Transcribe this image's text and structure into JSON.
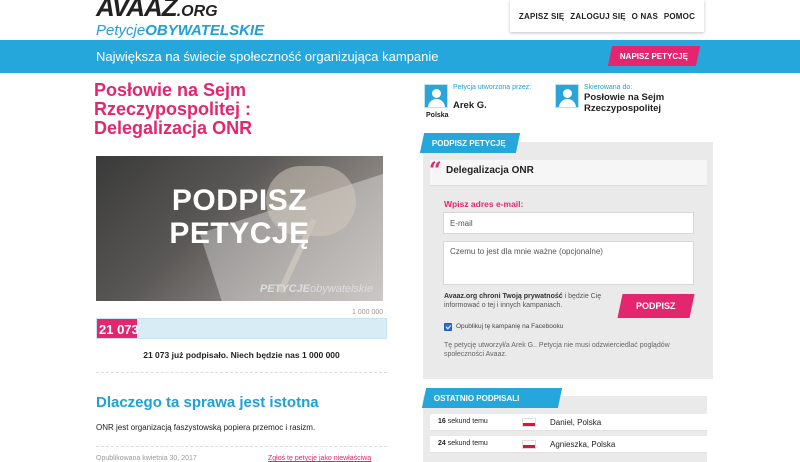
{
  "logo": {
    "main": "AVAAZ",
    "org": ".ORG",
    "sub_a": "Petycje",
    "sub_b": "OBYWATELSKIE"
  },
  "nav": {
    "items": [
      "ZAPISZ SIĘ",
      "ZALOGUJ SIĘ",
      "O NAS",
      "POMOC"
    ]
  },
  "banner": {
    "tagline": "Największa na świecie społeczność organizująca kampanie",
    "new_petition": "NAPISZ PETYCJĘ"
  },
  "petition": {
    "title": "Posłowie na Sejm Rzeczypospolitej : Delegalizacja ONR",
    "hero_line1": "PODPISZ",
    "hero_line2": "PETYCJĘ",
    "hero_brand_a": "PETYCJE",
    "hero_brand_b": "obywatelskie",
    "goal": "1 000 000",
    "count": "21 073",
    "progress_fraction": 0.021073,
    "signed_text": "21 073 już podpisało. Niech będzie nas 1 000 000",
    "why_title": "Dlaczego ta sprawa jest istotna",
    "why_text": "ONR jest organizacją faszystowską popiera przemoc i rasizm.",
    "published": "Opublikowana kwietnia 30, 2017",
    "report": "Zgłoś tę petycje jako niewłaściwą"
  },
  "creator": {
    "label": "Petycja utworzona przez:",
    "name": "Arek G.",
    "country": "Polska"
  },
  "recipient": {
    "label": "Skierowana do:",
    "name": "Posłowie na Sejm Rzeczypospolitej"
  },
  "sign": {
    "tab": "PODPISZ PETYCJĘ",
    "quote": "Delegalizacja ONR",
    "email_label": "Wpisz adres e-mail:",
    "email_placeholder": "E-mail",
    "reason_placeholder": "Czemu to jest dla mnie ważne (opcjonalne)",
    "privacy_bold": "Avaaz.org chroni Twoją prywatność",
    "privacy_rest": " i będzie Cię informować o tej i innych kampaniach.",
    "button": "PODPISZ",
    "fb_label": "Opublikuj tę kampanię na Facebooku",
    "disclaimer": "Tę petycję utworzył/a Arek G.. Petycja nie musi odzwierciedlać poglądów społeczności Avaaz."
  },
  "recent": {
    "tab": "OSTATNIO PODPISALI",
    "rows": [
      {
        "num": "16",
        "unit": " sekund temu",
        "name": "Daniel, Polska"
      },
      {
        "num": "24",
        "unit": " sekund temu",
        "name": "Agnieszka, Polska"
      }
    ]
  },
  "colors": {
    "accent_pink": "#e4266f",
    "accent_blue": "#25a7dc"
  }
}
